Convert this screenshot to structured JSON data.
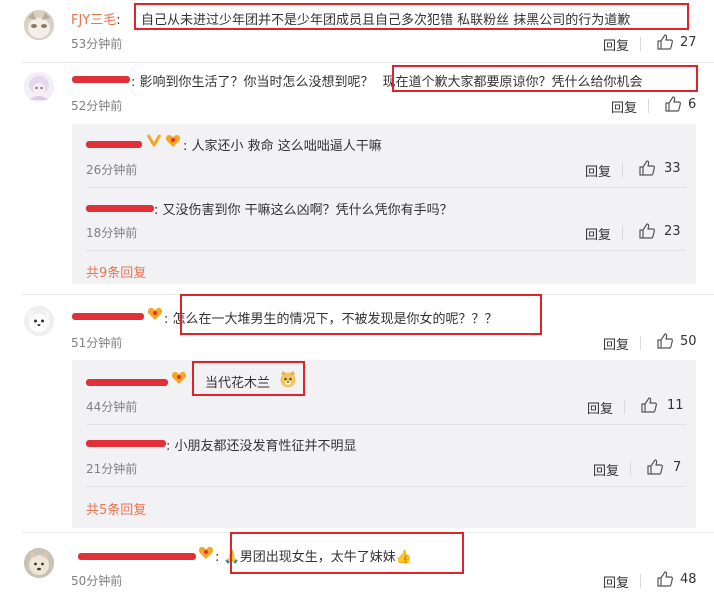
{
  "ui": {
    "reply_label": "回复",
    "accent_color": "#eb7350",
    "highlight_color": "#e0222b"
  },
  "comments": [
    {
      "user": "FJY三毛",
      "text": "自己从未进过少年团并不是少年团成员且自己多次犯错 私联粉丝 抹黑公司的行为道歉",
      "time": "53分钟前",
      "likes": "27"
    },
    {
      "user": "",
      "text_a": "影响到你生活了？你当时怎么没想到呢？",
      "text_b": "现在道个歉大家都要原谅你？凭什么给你机会",
      "time": "52分钟前",
      "likes": "6",
      "replies": [
        {
          "text": "人家还小 救命 这么咄咄逼人干嘛",
          "time": "26分钟前",
          "likes": "33"
        },
        {
          "text": "又没伤害到你 干嘛这么凶啊？凭什么凭你有手吗？",
          "time": "18分钟前",
          "likes": "23"
        }
      ],
      "more": "共9条回复"
    },
    {
      "user": "",
      "text": "怎么在一大堆男生的情况下，不被发现是你女的呢？？？",
      "time": "51分钟前",
      "likes": "50",
      "replies": [
        {
          "text": "当代花木兰",
          "time": "44分钟前",
          "likes": "11"
        },
        {
          "text": "小朋友都还没发育性征并不明显",
          "time": "21分钟前",
          "likes": "7"
        }
      ],
      "more": "共5条回复"
    },
    {
      "user": "",
      "text": "男团出现女生，太牛了妹妹",
      "time": "50分钟前",
      "likes": "48"
    }
  ]
}
